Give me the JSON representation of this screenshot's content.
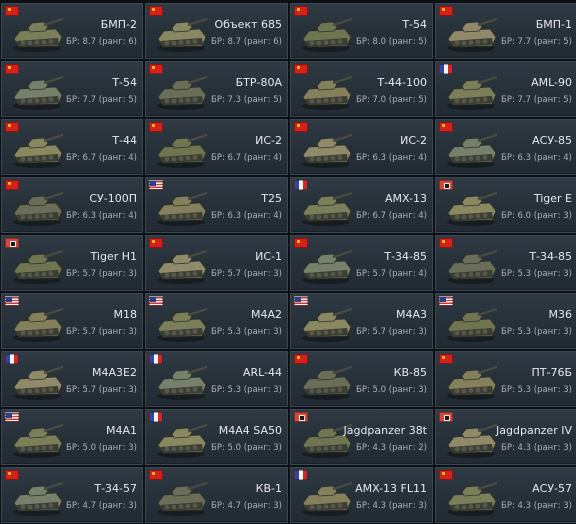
{
  "br_prefix": "БР:",
  "rank_prefix": "ранг:",
  "cards": [
    {
      "flag": "ussr",
      "name": "БМП-2",
      "br": "8.7",
      "rank": "6"
    },
    {
      "flag": "ussr",
      "name": "Объект 685",
      "br": "8.7",
      "rank": "6"
    },
    {
      "flag": "ussr",
      "name": "Т-54",
      "br": "8.0",
      "rank": "5"
    },
    {
      "flag": "ussr",
      "name": "БМП-1",
      "br": "7.7",
      "rank": "5"
    },
    {
      "flag": "ussr",
      "name": "Т-54",
      "br": "7.7",
      "rank": "5"
    },
    {
      "flag": "ussr",
      "name": "БТР-80А",
      "br": "7.3",
      "rank": "5"
    },
    {
      "flag": "ussr",
      "name": "Т-44-100",
      "br": "7.0",
      "rank": "5"
    },
    {
      "flag": "france",
      "name": "AML-90",
      "br": "7.7",
      "rank": "5"
    },
    {
      "flag": "ussr",
      "name": "Т-44",
      "br": "6.7",
      "rank": "4"
    },
    {
      "flag": "ussr",
      "name": "ИС-2",
      "br": "6.7",
      "rank": "4"
    },
    {
      "flag": "ussr",
      "name": "ИС-2",
      "br": "6.3",
      "rank": "4"
    },
    {
      "flag": "ussr",
      "name": "АСУ-85",
      "br": "6.3",
      "rank": "4"
    },
    {
      "flag": "ussr",
      "name": "СУ-100П",
      "br": "6.3",
      "rank": "4"
    },
    {
      "flag": "usa",
      "name": "T25",
      "br": "6.3",
      "rank": "4"
    },
    {
      "flag": "france",
      "name": "AMX-13",
      "br": "6.7",
      "rank": "4"
    },
    {
      "flag": "germany",
      "name": "Tiger E",
      "br": "6.0",
      "rank": "3"
    },
    {
      "flag": "germany",
      "name": "Tiger H1",
      "br": "5.7",
      "rank": "3"
    },
    {
      "flag": "ussr",
      "name": "ИС-1",
      "br": "5.7",
      "rank": "3"
    },
    {
      "flag": "ussr",
      "name": "Т-34-85",
      "br": "5.7",
      "rank": "4"
    },
    {
      "flag": "ussr",
      "name": "Т-34-85",
      "br": "5.3",
      "rank": "3"
    },
    {
      "flag": "usa",
      "name": "M18",
      "br": "5.7",
      "rank": "3"
    },
    {
      "flag": "usa",
      "name": "M4A2",
      "br": "5.3",
      "rank": "3"
    },
    {
      "flag": "usa",
      "name": "M4A3",
      "br": "5.7",
      "rank": "3"
    },
    {
      "flag": "usa",
      "name": "M36",
      "br": "5.3",
      "rank": "3"
    },
    {
      "flag": "france",
      "name": "M4A3E2",
      "br": "5.7",
      "rank": "3"
    },
    {
      "flag": "france",
      "name": "ARL-44",
      "br": "5.3",
      "rank": "3"
    },
    {
      "flag": "ussr",
      "name": "КВ-85",
      "br": "5.0",
      "rank": "3"
    },
    {
      "flag": "ussr",
      "name": "ПТ-76Б",
      "br": "5.3",
      "rank": "3"
    },
    {
      "flag": "usa",
      "name": "M4A1",
      "br": "5.0",
      "rank": "3"
    },
    {
      "flag": "france",
      "name": "M4A4 SA50",
      "br": "5.0",
      "rank": "3"
    },
    {
      "flag": "germany",
      "name": "Jagdpanzer 38t",
      "br": "4.3",
      "rank": "2"
    },
    {
      "flag": "germany",
      "name": "Jagdpanzer IV",
      "br": "4.3",
      "rank": "3"
    },
    {
      "flag": "ussr",
      "name": "Т-34-57",
      "br": "4.7",
      "rank": "3"
    },
    {
      "flag": "ussr",
      "name": "КВ-1",
      "br": "4.7",
      "rank": "3"
    },
    {
      "flag": "france",
      "name": "AMX-13 FL11",
      "br": "4.3",
      "rank": "3"
    },
    {
      "flag": "ussr",
      "name": "АСУ-57",
      "br": "4.3",
      "rank": "3"
    }
  ]
}
